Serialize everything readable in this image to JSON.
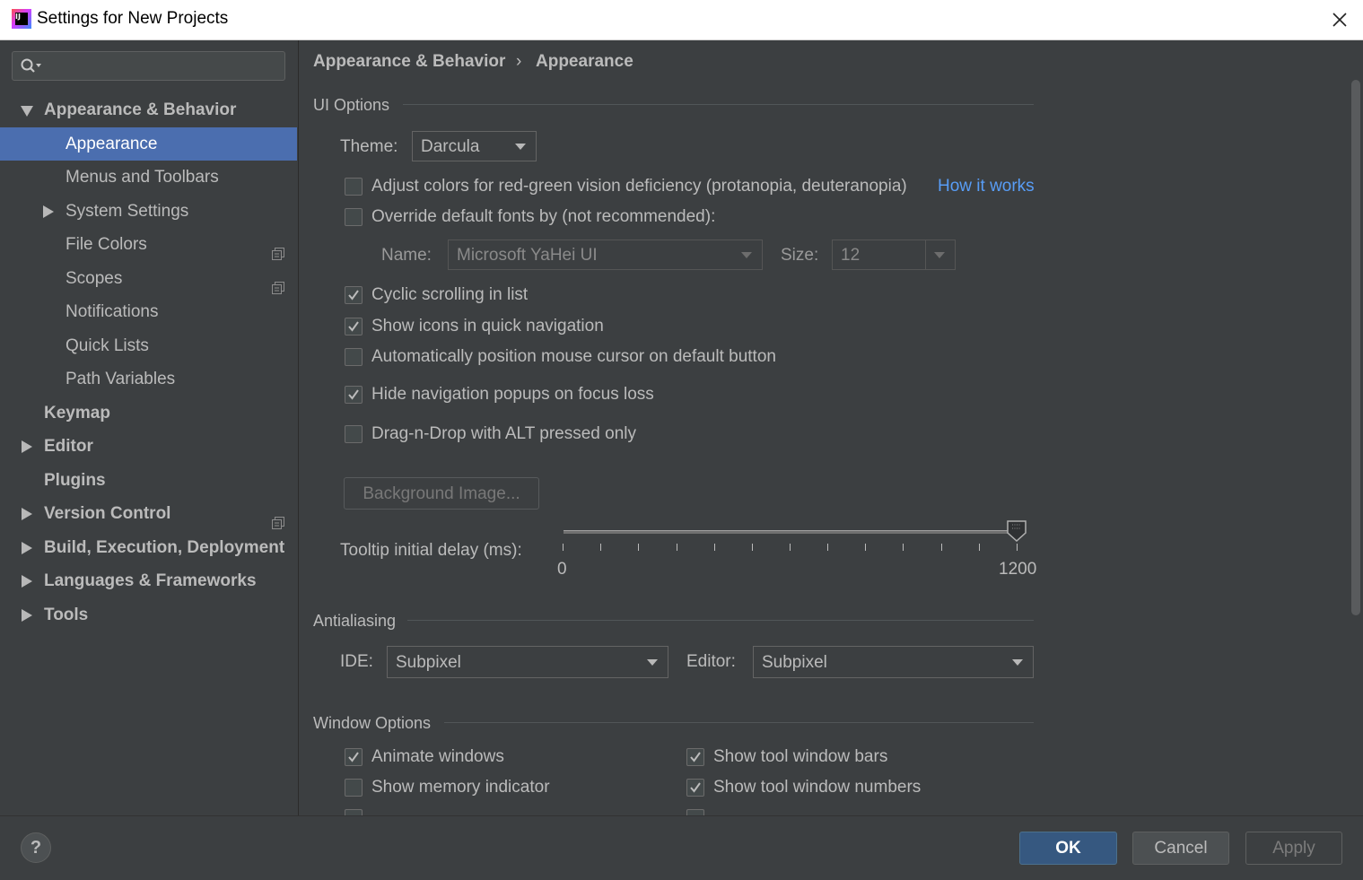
{
  "window": {
    "title": "Settings for New Projects",
    "app_icon_text": "IJ"
  },
  "sidebar": {
    "search_placeholder": "",
    "items": [
      {
        "label": "Appearance & Behavior",
        "expanded": true
      },
      {
        "label": "Appearance",
        "selected": true
      },
      {
        "label": "Menus and Toolbars"
      },
      {
        "label": "System Settings"
      },
      {
        "label": "File Colors"
      },
      {
        "label": "Scopes"
      },
      {
        "label": "Notifications"
      },
      {
        "label": "Quick Lists"
      },
      {
        "label": "Path Variables"
      },
      {
        "label": "Keymap"
      },
      {
        "label": "Editor"
      },
      {
        "label": "Plugins"
      },
      {
        "label": "Version Control"
      },
      {
        "label": "Build, Execution, Deployment"
      },
      {
        "label": "Languages & Frameworks"
      },
      {
        "label": "Tools"
      }
    ]
  },
  "breadcrumb": {
    "parent": "Appearance & Behavior",
    "separator": "›",
    "current": "Appearance"
  },
  "ui_options": {
    "section_title": "UI Options",
    "theme_label": "Theme:",
    "theme_value": "Darcula",
    "adjust_colors": {
      "label": "Adjust colors for red-green vision deficiency (protanopia, deuteranopia)",
      "checked": false
    },
    "how_it_works": "How it works",
    "override_fonts": {
      "label": "Override default fonts by (not recommended):",
      "checked": false
    },
    "font_name_label": "Name:",
    "font_name_value": "Microsoft YaHei UI",
    "font_size_label": "Size:",
    "font_size_value": "12",
    "cyclic_scrolling": {
      "label": "Cyclic scrolling in list",
      "checked": true
    },
    "show_icons": {
      "label": "Show icons in quick navigation",
      "checked": true
    },
    "auto_position": {
      "label": "Automatically position mouse cursor on default button",
      "checked": false
    },
    "hide_popups": {
      "label": "Hide navigation popups on focus loss",
      "checked": true
    },
    "drag_n_drop": {
      "label": "Drag-n-Drop with ALT pressed only",
      "checked": false
    },
    "background_image_button": "Background Image...",
    "tooltip_label": "Tooltip initial delay (ms):",
    "tooltip_min": "0",
    "tooltip_max": "1200",
    "tooltip_value": 1200
  },
  "antialiasing": {
    "section_title": "Antialiasing",
    "ide_label": "IDE:",
    "ide_value": "Subpixel",
    "editor_label": "Editor:",
    "editor_value": "Subpixel"
  },
  "window_options": {
    "section_title": "Window Options",
    "animate_windows": {
      "label": "Animate windows",
      "checked": true
    },
    "show_memory": {
      "label": "Show memory indicator",
      "checked": false
    },
    "show_tool_bars": {
      "label": "Show tool window bars",
      "checked": true
    },
    "show_tool_numbers": {
      "label": "Show tool window numbers",
      "checked": true
    }
  },
  "footer": {
    "help": "?",
    "ok": "OK",
    "cancel": "Cancel",
    "apply": "Apply"
  },
  "colors": {
    "background": "#3c3f41",
    "selection": "#4b6eaf",
    "link": "#589df6",
    "text": "#bbbbbb"
  }
}
